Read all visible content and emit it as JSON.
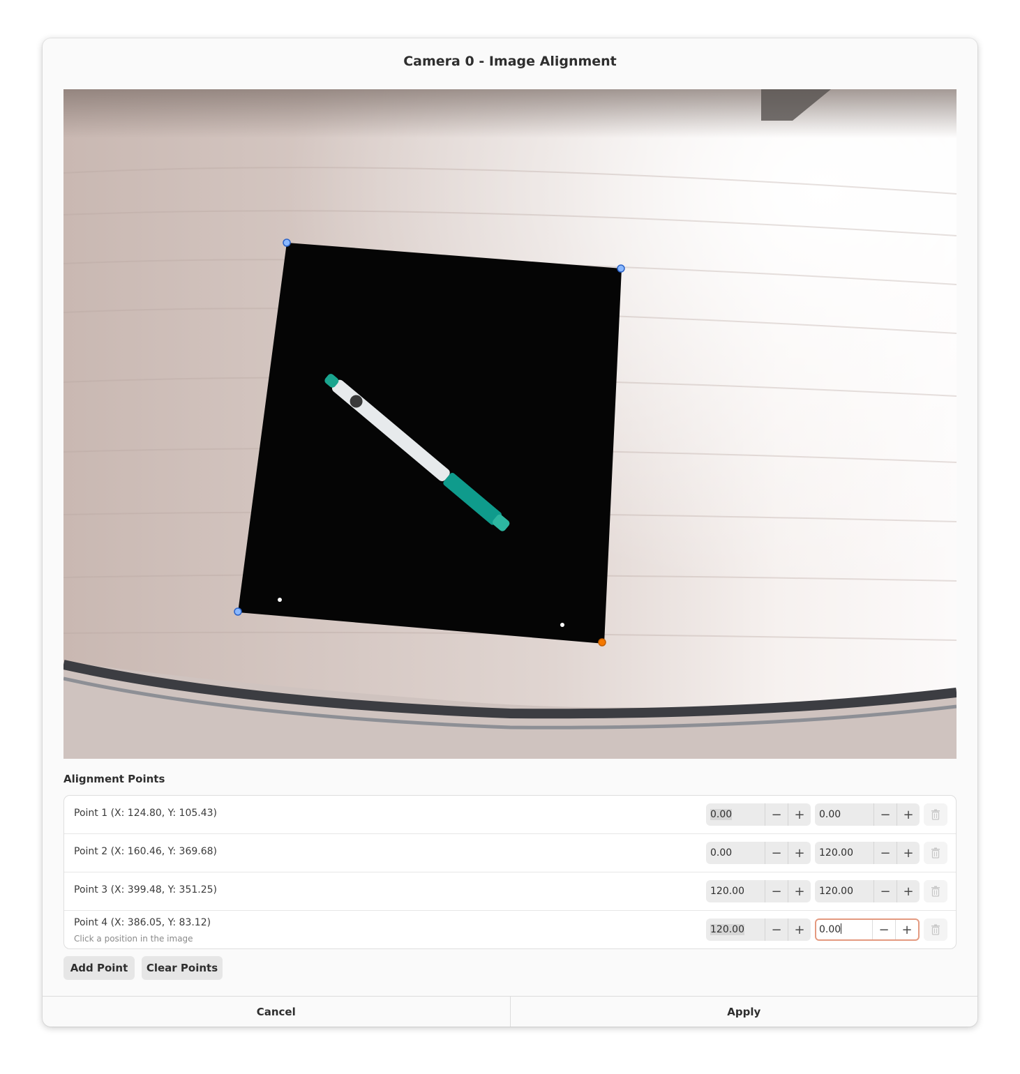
{
  "dialog": {
    "title": "Camera 0 - Image Alignment",
    "section_label": "Alignment Points",
    "add_point_label": "Add Point",
    "clear_points_label": "Clear Points",
    "cancel_label": "Cancel",
    "apply_label": "Apply"
  },
  "points": [
    {
      "label": "Point 1 (X: 124.80, Y: 105.43)",
      "x_value": "0.00",
      "y_value": "0.00"
    },
    {
      "label": "Point 2 (X: 160.46, Y: 369.68)",
      "x_value": "0.00",
      "y_value": "120.00"
    },
    {
      "label": "Point 3 (X: 399.48, Y: 351.25)",
      "x_value": "120.00",
      "y_value": "120.00"
    },
    {
      "label": "Point 4 (X: 386.05, Y: 83.12)",
      "hint": "Click a position in the image",
      "x_value": "120.00",
      "y_value": "0.00"
    }
  ],
  "glyphs": {
    "minus": "−",
    "plus": "+"
  },
  "colors": {
    "marker_blue": "#8ab8ff",
    "marker_active": "#f57900",
    "focus_border": "#e49a80"
  }
}
